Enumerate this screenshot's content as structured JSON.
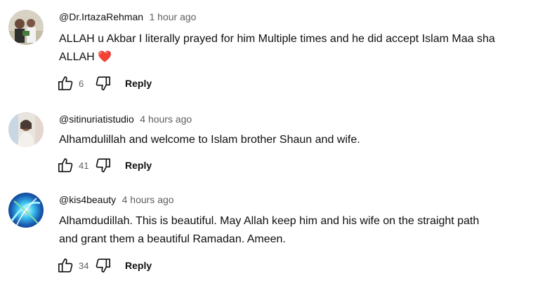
{
  "comments": [
    {
      "author": "@Dr.IrtazaRehman",
      "time": "1 hour ago",
      "text_line1": "ALLAH u Akbar I literally prayed for him Multiple times and he did accept Islam Maa sha",
      "text_line2": "ALLAH",
      "emoji": "❤️",
      "likes": "6",
      "reply_label": "Reply"
    },
    {
      "author": "@sitinuriatistudio",
      "time": "4 hours ago",
      "text_line1": "Alhamdulillah and welcome to Islam brother Shaun and wife.",
      "likes": "41",
      "reply_label": "Reply"
    },
    {
      "author": "@kis4beauty",
      "time": "4 hours ago",
      "text_line1": "Alhamdudillah. This is beautiful. May Allah keep him and his wife on the straight path",
      "text_line2": "and grant them a beautiful Ramadan. Ameen.",
      "likes": "34",
      "reply_label": "Reply"
    }
  ],
  "colors": {
    "text_primary": "#0f0f0f",
    "text_secondary": "#606060",
    "heart": "#e53935"
  }
}
